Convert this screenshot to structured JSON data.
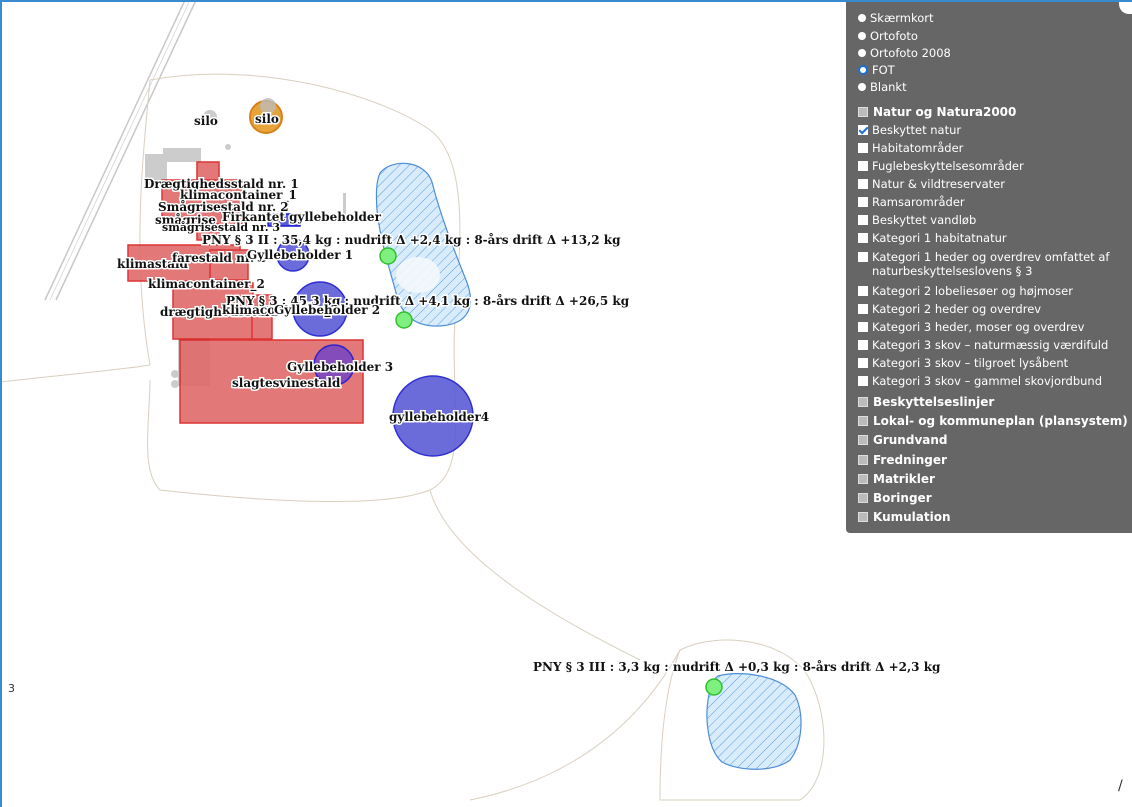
{
  "map": {
    "labels": {
      "silo_1": "silo",
      "silo_2": "silo",
      "draegtighedsstald_1": "Drægtighedsstald nr. 1",
      "klimacontainer_1": "klimacontainer_1",
      "smaagrisestald_2": "Smågrisestald nr. 2",
      "smaagrise_firkantet": "smågrise",
      "firkantet_gylle": "Firkantet gyllebeholder",
      "smaagrisestald_3": "smågrisestald nr. 3",
      "pny_1": "PNY § 3 II : 35,4 kg : nudrift Δ +2,4 kg : 8-års drift Δ +13,2 kg",
      "klimastald": "klimastald",
      "farestald": "farestald nr. 3",
      "gyllebeholder_1": "Gyllebeholder 1",
      "klimacontainer_2": "klimacontainer_2",
      "pny_2": "PNY § 3 : 45,3 kg : nudrift Δ +4,1 kg : 8-års drift Δ +26,5 kg",
      "draegtighed_2": "drægtighedsstald",
      "klimacont_3": "klimacontainer_3",
      "gyllebeholder_2": "Gyllebeholder 2",
      "gyllebeholder_3": "Gyllebeholder 3",
      "slagtesvinestald": "slagtesvinestald",
      "gyllebeholder_4": "gyllebeholder4",
      "pny_3": "PNY § 3 III : 3,3 kg : nudrift Δ +0,3 kg : 8-års drift Δ +2,3 kg"
    },
    "edge_mark": "3",
    "north_arrow": "/"
  },
  "panel": {
    "base_layers": [
      {
        "label": "Skærmkort",
        "selected": false
      },
      {
        "label": "Ortofoto",
        "selected": false
      },
      {
        "label": "Ortofoto 2008",
        "selected": false
      },
      {
        "label": "FOT",
        "selected": true
      },
      {
        "label": "Blankt",
        "selected": false
      }
    ],
    "group_natur": "Natur og Natura2000",
    "natur_items": [
      {
        "label": "Beskyttet natur",
        "checked": true
      },
      {
        "label": "Habitatområder",
        "checked": false
      },
      {
        "label": "Fuglebeskyttelsesområder",
        "checked": false
      },
      {
        "label": "Natur & vildtreservater",
        "checked": false
      },
      {
        "label": "Ramsarområder",
        "checked": false
      },
      {
        "label": "Beskyttet vandløb",
        "checked": false
      },
      {
        "label": "Kategori 1 habitatnatur",
        "checked": false
      },
      {
        "label": "Kategori 1 heder og overdrev omfattet af naturbeskyttelseslovens § 3",
        "checked": false
      },
      {
        "label": "Kategori 2 lobeliesøer og højmoser",
        "checked": false
      },
      {
        "label": "Kategori 2 heder og overdrev",
        "checked": false
      },
      {
        "label": "Kategori 3 heder, moser og overdrev",
        "checked": false
      },
      {
        "label": "Kategori 3 skov – naturmæssig værdifuld",
        "checked": false
      },
      {
        "label": "Kategori 3 skov – tilgroet lysåbent",
        "checked": false
      },
      {
        "label": "Kategori 3 skov – gammel skovjordbund",
        "checked": false
      }
    ],
    "groups": [
      "Beskyttelseslinjer",
      "Lokal- og kommuneplan (plansystem)",
      "Grundvand",
      "Fredninger",
      "Matrikler",
      "Boringer",
      "Kumulation"
    ]
  },
  "colors": {
    "building_fill": "#e06a6a",
    "building_stroke": "#d91f1f",
    "tank_fill": "#5b5bd6",
    "tank_stroke": "#1a1ad0",
    "nature_fill": "#d6ecfa",
    "nature_stroke": "#4d8ed6",
    "point_fill": "#7ff07f",
    "panel_bg": "#666666"
  }
}
